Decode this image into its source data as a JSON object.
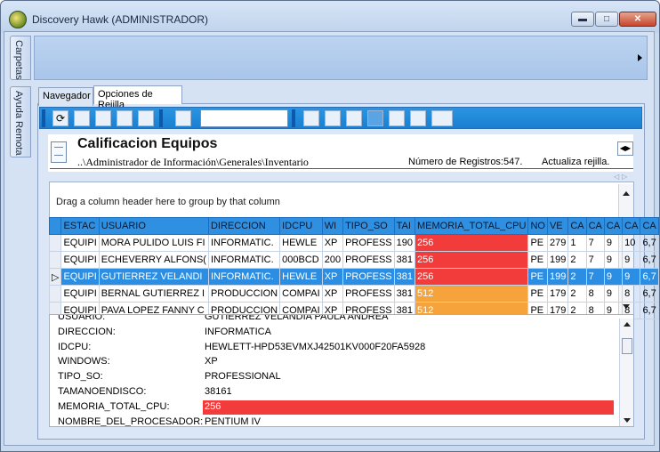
{
  "window": {
    "title": "Discovery Hawk (ADMINISTRADOR)"
  },
  "left_tabs": {
    "carpetas": "Carpetas",
    "ayuda": "Ayuda Remota"
  },
  "tabs": {
    "navegador": "Navegador",
    "opciones": "Opciones de Rejilla"
  },
  "toolbar": {
    "search_value": ""
  },
  "header": {
    "title": "Calificacion Equipos",
    "path": "..\\Administrador de Información\\Generales\\Inventario",
    "record_count": "Número de Registros:547.",
    "refresh": "Actualiza rejilla."
  },
  "grid": {
    "group_hint": "Drag a column header here to group by that column",
    "columns": [
      "ESTAC",
      "USUARIO",
      "DIRECCION",
      "IDCPU",
      "WI",
      "TIPO_SO",
      "TAI",
      "MEMORIA_TOTAL_CPU",
      "NO",
      "VE",
      "CA",
      "CA",
      "CA",
      "CA",
      "CA"
    ],
    "rows": [
      [
        "EQUIPI",
        "MORA PULIDO LUIS FI",
        "INFORMATIC.",
        "HEWLE",
        "XP",
        "PROFESS",
        "190",
        "256",
        "PE",
        "279",
        "1",
        "7",
        "9",
        "10",
        "6,7"
      ],
      [
        "EQUIPI",
        "ECHEVERRY ALFONS(",
        "INFORMATIC.",
        "000BCD",
        "200",
        "PROFESS",
        "381",
        "256",
        "PE",
        "199",
        "2",
        "7",
        "9",
        "9",
        "6,7"
      ],
      [
        "EQUIPI",
        "GUTIERREZ VELANDI",
        "INFORMATIC.",
        "HEWLE",
        "XP",
        "PROFESS",
        "381",
        "256",
        "PE",
        "199",
        "2",
        "7",
        "9",
        "9",
        "6,7"
      ],
      [
        "EQUIPI",
        "BERNAL GUTIERREZ I",
        "PRODUCCION",
        "COMPAI",
        "XP",
        "PROFESS",
        "381",
        "512",
        "PE",
        "179",
        "2",
        "8",
        "9",
        "8",
        "6,7"
      ],
      [
        "EQUIPI",
        "PAVA LOPEZ FANNY C",
        "PRODUCCION",
        "COMPAI",
        "XP",
        "PROFESS",
        "381",
        "512",
        "PE",
        "179",
        "2",
        "8",
        "9",
        "8",
        "6,7"
      ]
    ],
    "memory_colors": [
      "#f23b3b",
      "#f23b3b",
      "#f23b3b",
      "#f7a33c",
      "#f7a33c"
    ],
    "selected_row": 3
  },
  "detail": {
    "rows": [
      {
        "label": "USUARIO:",
        "value": "GUTIERREZ VELANDIA PAULA ANDREA"
      },
      {
        "label": "DIRECCION:",
        "value": "INFORMATICA"
      },
      {
        "label": "IDCPU:",
        "value": "HEWLETT-HPD53EVMXJ42501KV000F20FA5928"
      },
      {
        "label": "WINDOWS:",
        "value": "XP"
      },
      {
        "label": "TIPO_SO:",
        "value": "PROFESSIONAL"
      },
      {
        "label": "TAMANOENDISCO:",
        "value": "38161"
      },
      {
        "label": "MEMORIA_TOTAL_CPU:",
        "value": "256"
      },
      {
        "label": "NOMBRE_DEL_PROCESADOR:",
        "value": "PENTIUM IV"
      }
    ]
  }
}
